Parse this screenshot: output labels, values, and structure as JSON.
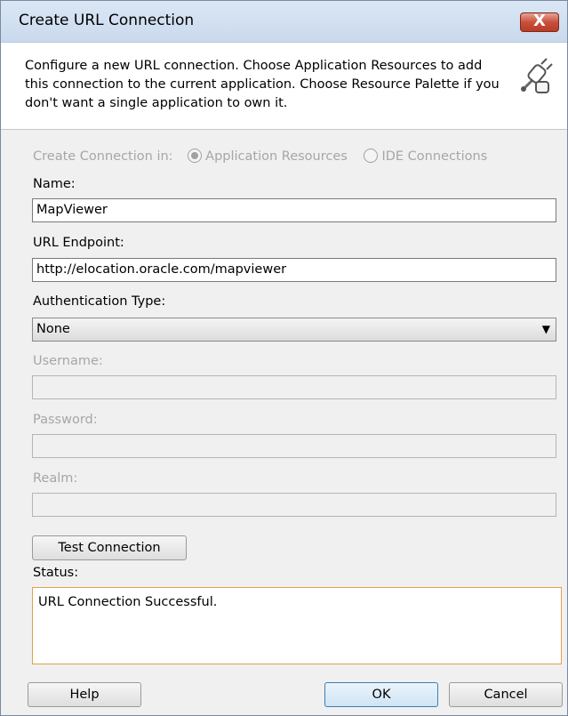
{
  "window": {
    "title": "Create URL Connection",
    "close_label": "X"
  },
  "header": {
    "description": "Configure a new URL connection.  Choose Application Resources to add this connection to the current application. Choose Resource Palette if you don't want a single application to own it.",
    "icon": "connection-plug-icon"
  },
  "create_in": {
    "label": "Create Connection in:",
    "options": [
      {
        "label": "Application Resources",
        "checked": true
      },
      {
        "label": "IDE Connections",
        "checked": false
      }
    ]
  },
  "name": {
    "label": "Name:",
    "value": "MapViewer"
  },
  "url_endpoint": {
    "label": "URL Endpoint:",
    "value": "http://elocation.oracle.com/mapviewer"
  },
  "auth_type": {
    "label": "Authentication Type:",
    "value": "None"
  },
  "username": {
    "label": "Username:",
    "value": ""
  },
  "password": {
    "label": "Password:",
    "value": ""
  },
  "realm": {
    "label": "Realm:",
    "value": ""
  },
  "test_button": {
    "label": "Test Connection"
  },
  "status": {
    "label": "Status:",
    "value": "URL Connection Successful."
  },
  "buttons": {
    "help": "Help",
    "ok": "OK",
    "cancel": "Cancel"
  },
  "colors": {
    "title_bar": "#c9d9ed",
    "close": "#c9503c",
    "status_border": "#e3a24a"
  }
}
